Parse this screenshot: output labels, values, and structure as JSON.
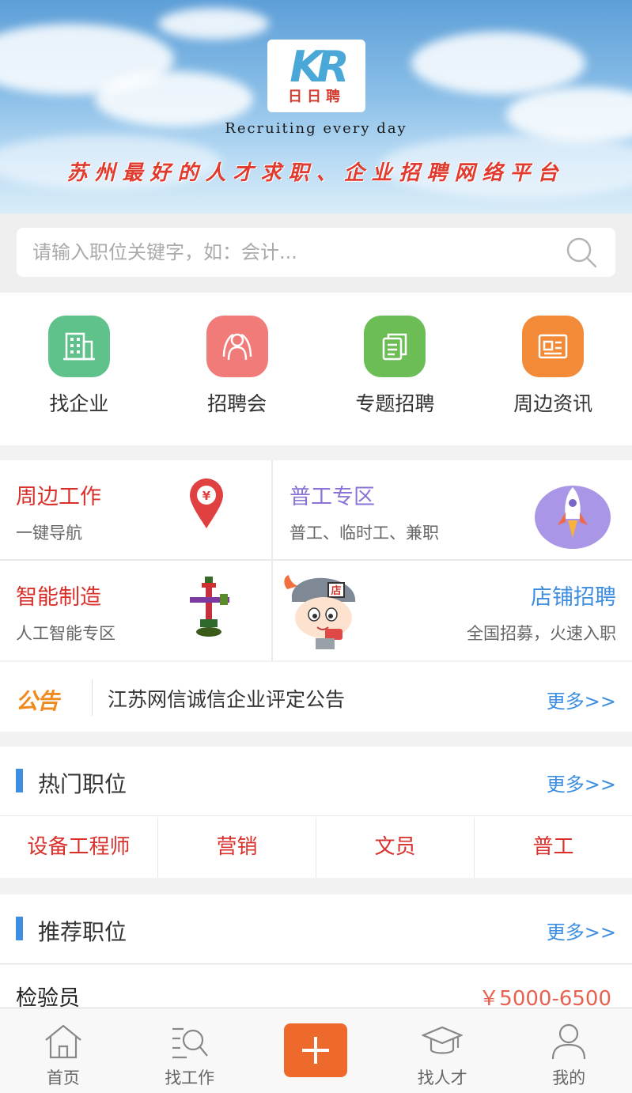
{
  "banner": {
    "logo_mark": "KR",
    "logo_name": "日日聘",
    "tagline_en": "Recruiting every day",
    "tagline_cn": "苏州最好的人才求职、企业招聘网络平台"
  },
  "search": {
    "placeholder": "请输入职位关键字，如：会计..."
  },
  "quick_nav": [
    {
      "label": "找企业",
      "icon": "building-icon",
      "color": "#5ec28a"
    },
    {
      "label": "招聘会",
      "icon": "people-icon",
      "color": "#f07b78"
    },
    {
      "label": "专题招聘",
      "icon": "documents-icon",
      "color": "#6dbd57"
    },
    {
      "label": "周边资讯",
      "icon": "news-icon",
      "color": "#f28a38"
    }
  ],
  "features": {
    "nearby": {
      "title": "周边工作",
      "sub": "一键导航",
      "icon": "location-pin-icon"
    },
    "general": {
      "title": "普工专区",
      "sub": "普工、临时工、兼职",
      "icon": "rocket-icon"
    },
    "smart": {
      "title": "智能制造",
      "sub": "人工智能专区",
      "icon": "valve-icon"
    },
    "shop": {
      "title": "店铺招聘",
      "sub": "全国招募，火速入职",
      "icon": "shop-mascot-icon",
      "badge": "店"
    }
  },
  "notice": {
    "logo": "公告",
    "text": "江苏网信诚信企业评定公告",
    "more": "更多>>"
  },
  "hot_jobs": {
    "title": "热门职位",
    "more": "更多>>",
    "tags": [
      "设备工程师",
      "营销",
      "文员",
      "普工"
    ]
  },
  "recommended": {
    "title": "推荐职位",
    "more": "更多>>",
    "jobs": [
      {
        "name": "检验员",
        "salary": "￥5000-6500"
      }
    ]
  },
  "tabbar": [
    {
      "label": "首页",
      "icon": "home-icon"
    },
    {
      "label": "找工作",
      "icon": "job-search-icon"
    },
    {
      "label": "",
      "icon": "plus-icon"
    },
    {
      "label": "找人才",
      "icon": "graduation-cap-icon"
    },
    {
      "label": "我的",
      "icon": "user-icon"
    }
  ],
  "colors": {
    "accent_blue": "#3d8ee0",
    "accent_red": "#d9302c",
    "plus_orange": "#ee6a2c",
    "general_purple": "#8b72d6",
    "salary": "#e86050"
  }
}
